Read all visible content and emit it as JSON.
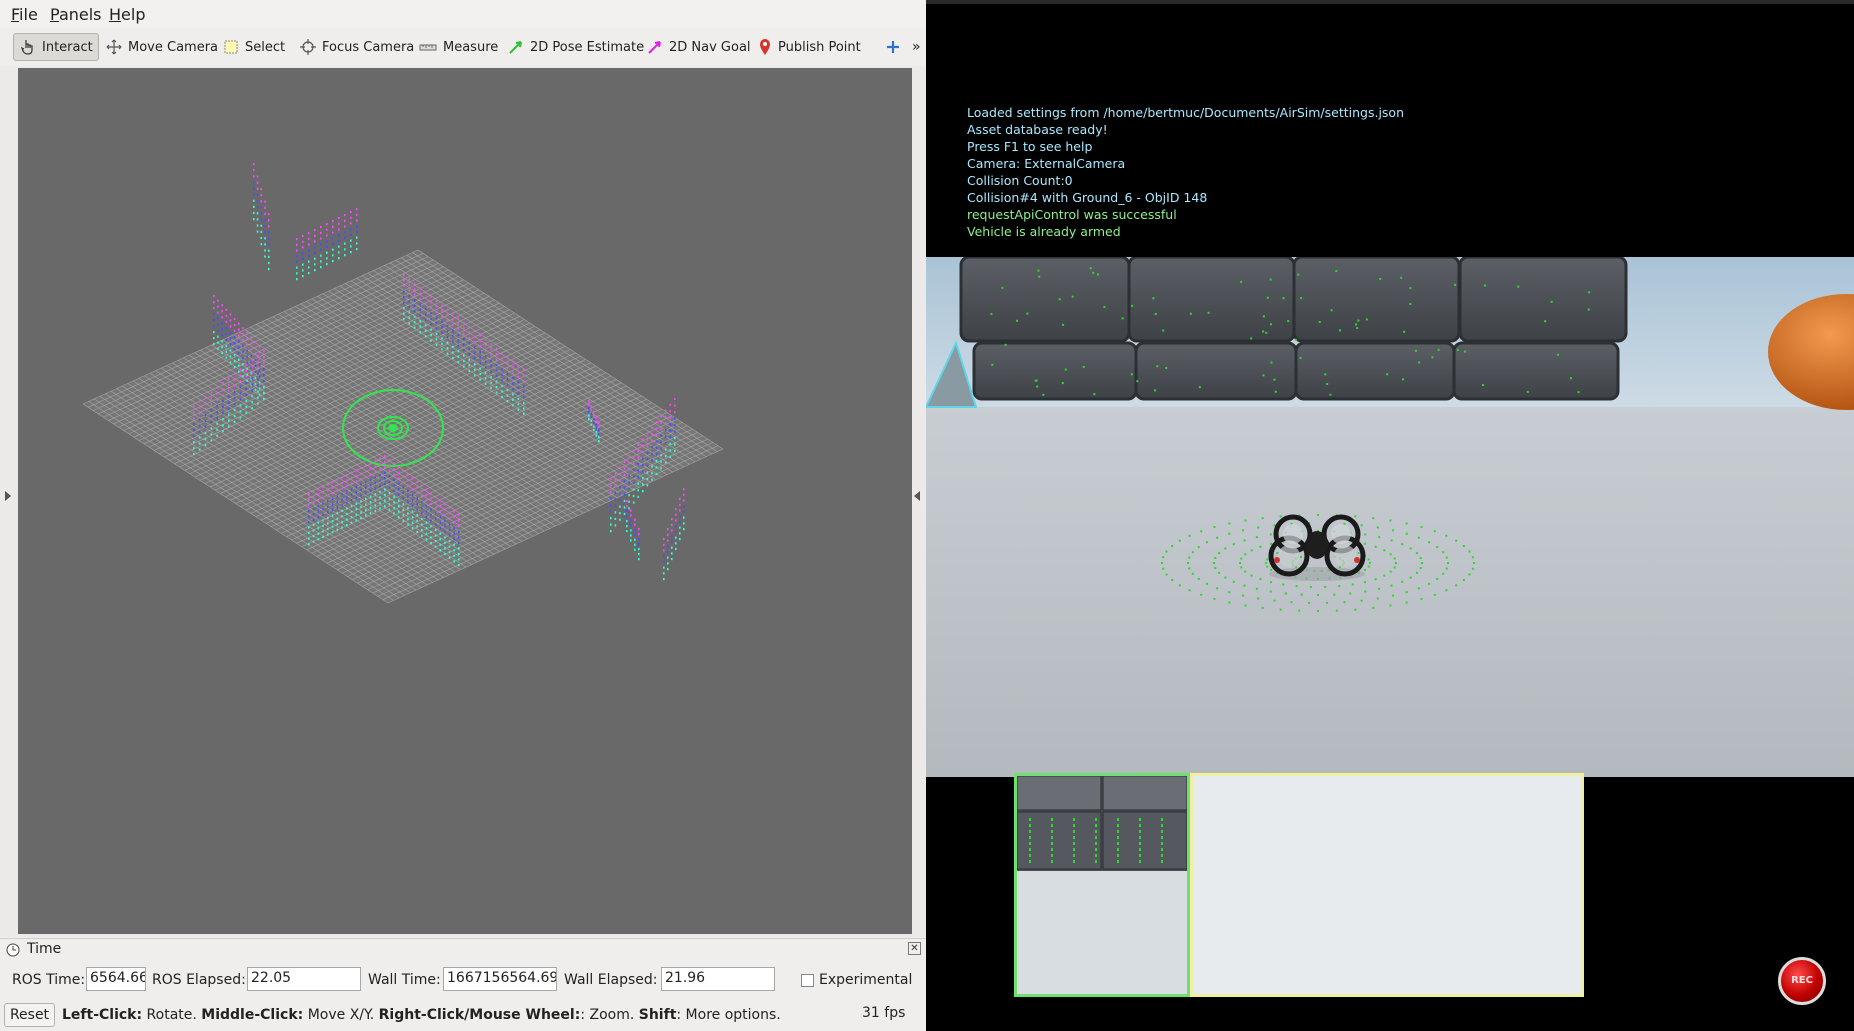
{
  "menubar": {
    "items": [
      {
        "label_first": "F",
        "label_rest": "ile"
      },
      {
        "label_first": "P",
        "label_rest": "anels"
      },
      {
        "label_first": "H",
        "label_rest": "elp"
      }
    ]
  },
  "toolbar": {
    "interact": "Interact",
    "move_camera": "Move Camera",
    "select": "Select",
    "focus_camera": "Focus Camera",
    "measure": "Measure",
    "pose_estimate": "2D Pose Estimate",
    "nav_goal": "2D Nav Goal",
    "publish_point": "Publish Point",
    "more": "»"
  },
  "time_panel": {
    "title": "Time",
    "ros_time_label": "ROS Time:",
    "ros_time_value": "6564.66",
    "ros_elapsed_label": "ROS Elapsed:",
    "ros_elapsed_value": "22.05",
    "wall_time_label": "Wall Time:",
    "wall_time_value": "1667156564.69",
    "wall_elapsed_label": "Wall Elapsed:",
    "wall_elapsed_value": "21.96",
    "experimental_label": "Experimental",
    "experimental_checked": false
  },
  "statusbar": {
    "reset": "Reset",
    "left_click": "Left-Click:",
    "left_click_desc": " Rotate. ",
    "middle_click": "Middle-Click:",
    "middle_click_desc": " Move X/Y. ",
    "right_click": "Right-Click/Mouse Wheel:",
    "right_click_desc": ": Zoom. ",
    "shift": "Shift",
    "shift_desc": ": More options.",
    "fps": "31 fps"
  },
  "airsim": {
    "log": [
      {
        "text": "Loaded settings from /home/bertmuc/Documents/AirSim/settings.json",
        "color": "#a9e8ff"
      },
      {
        "text": "Asset database ready!",
        "color": "#a9e8ff"
      },
      {
        "text": "Press F1 to see help",
        "color": "#a9e8ff"
      },
      {
        "text": "Camera: ExternalCamera",
        "color": "#a9e8ff"
      },
      {
        "text": "Collision Count:0",
        "color": "#a9e8ff"
      },
      {
        "text": "Collision#4 with Ground_6 - ObjID 148",
        "color": "#a9e8ff"
      },
      {
        "text": "requestApiControl was successful",
        "color": "#8ef08e"
      },
      {
        "text": "Vehicle is already armed",
        "color": "#8ef08e"
      }
    ],
    "rec_label": "REC"
  },
  "colors": {
    "viewport_bg": "#696969",
    "grid": "#b4b4b4",
    "target_ring": "#2ee84a",
    "pointcloud_high": "#ff44ff",
    "pointcloud_mid": "#4a4aff",
    "pointcloud_low": "#33ffcc",
    "scene_point": "#2bd92b"
  }
}
